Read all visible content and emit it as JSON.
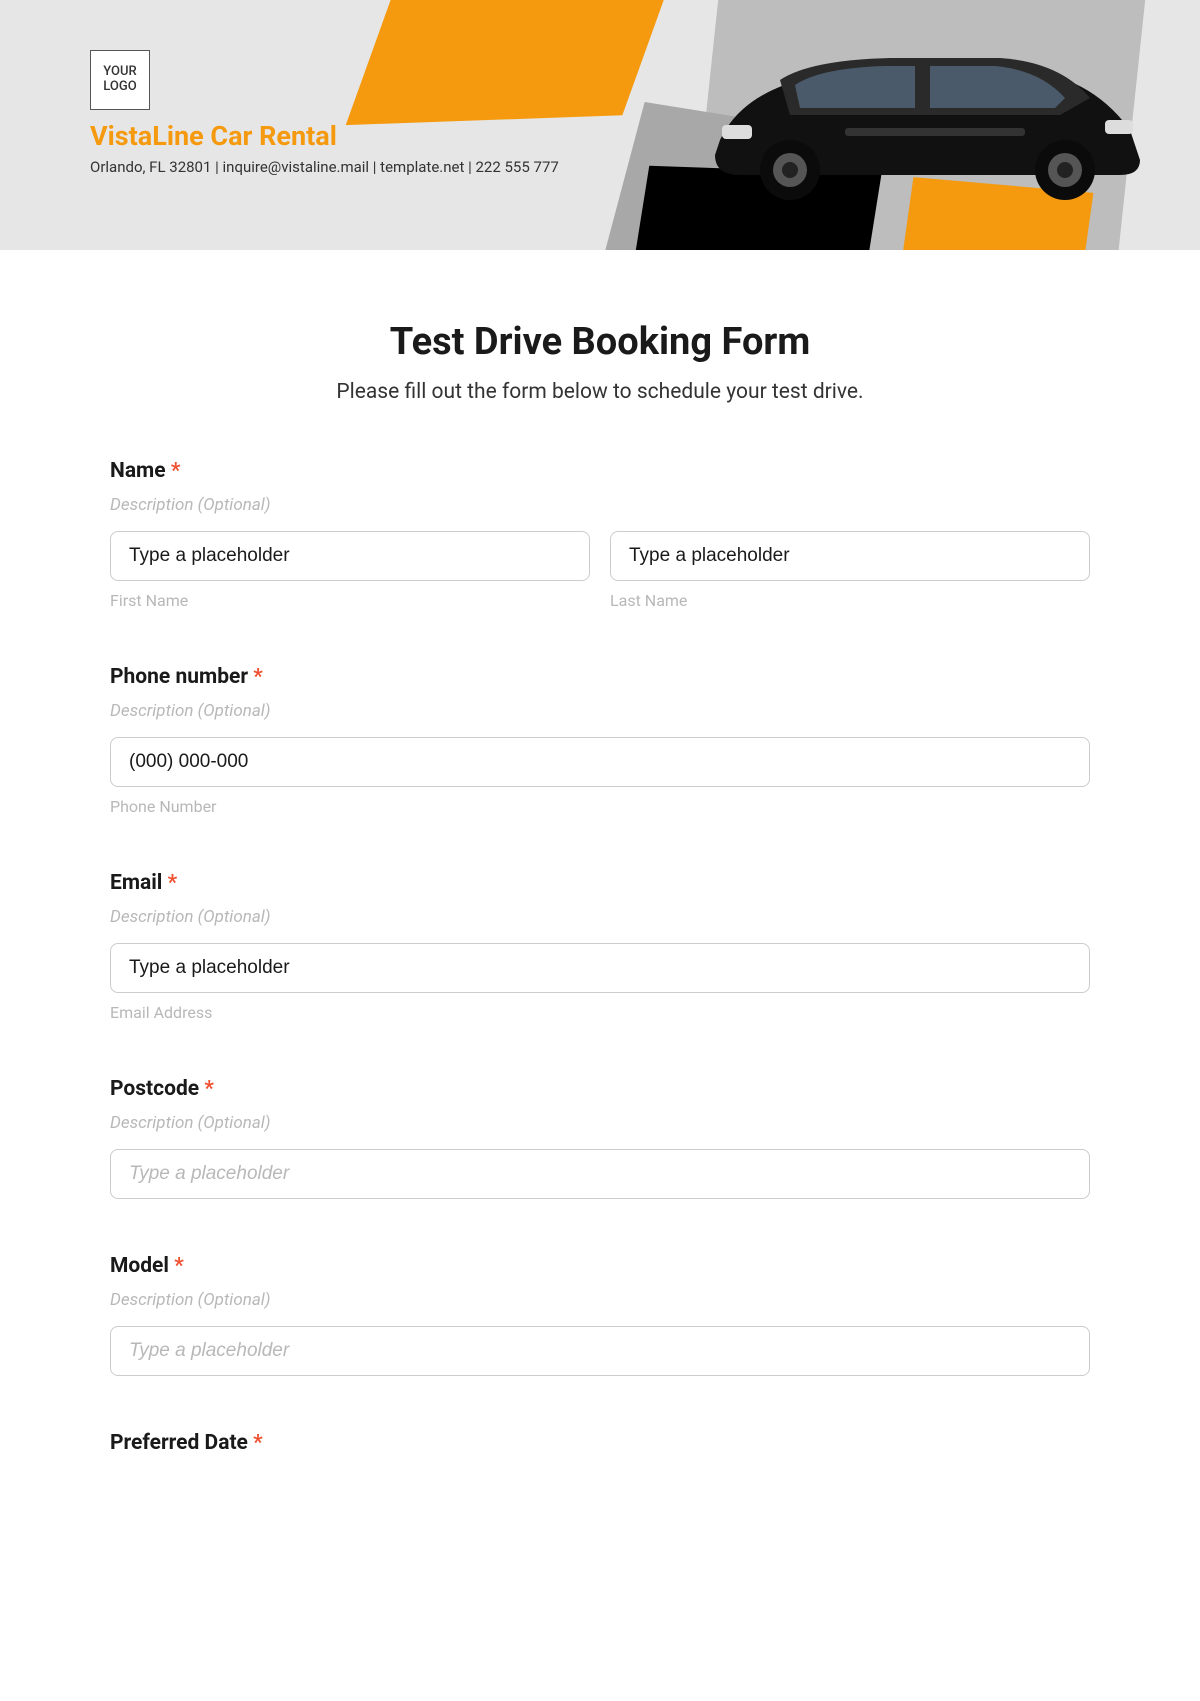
{
  "header": {
    "logo_text": "YOUR LOGO",
    "company": "VistaLine Car Rental",
    "contact": "Orlando, FL 32801 | inquire@vistaline.mail | template.net | 222 555 777"
  },
  "form": {
    "title": "Test Drive Booking Form",
    "subtitle": "Please fill out the form below to schedule your test drive.",
    "desc_text": "Description (Optional)",
    "name": {
      "label": "Name",
      "first_placeholder": "Type a placeholder",
      "first_sub": "First Name",
      "last_placeholder": "Type a placeholder",
      "last_sub": "Last Name"
    },
    "phone": {
      "label": "Phone number",
      "placeholder": "(000) 000-000",
      "sub": "Phone Number"
    },
    "email": {
      "label": "Email",
      "placeholder": "Type a placeholder",
      "sub": "Email Address"
    },
    "postcode": {
      "label": "Postcode",
      "placeholder": "Type a placeholder"
    },
    "model": {
      "label": "Model",
      "placeholder": "Type a placeholder"
    },
    "date": {
      "label": "Preferred Date"
    }
  }
}
